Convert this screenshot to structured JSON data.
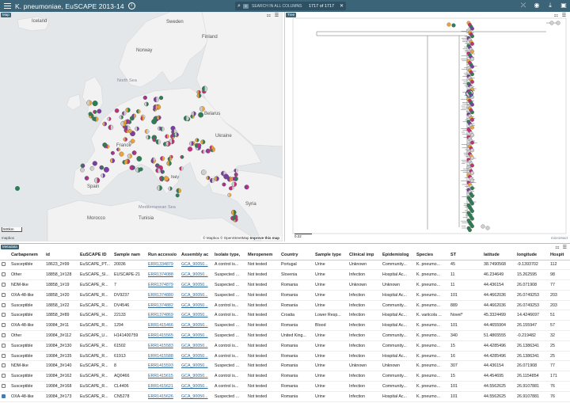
{
  "header": {
    "title": "K. pneumoniae, EuSCAPE 2013-14",
    "search_placeholder": "SEARCH IN ALL COLUMNS",
    "search_count_label": "1717 of 1717",
    "info_icon": "info-icon",
    "icons": [
      "menu-icon",
      "search-icon",
      "close-icon",
      "lasso-icon",
      "eye-icon",
      "download-icon",
      "save-icon"
    ]
  },
  "map": {
    "tag": "Map",
    "labels": {
      "iceland": "Iceland",
      "sweden": "Sweden",
      "finland": "Finland",
      "norway": "Norway",
      "north_sea": "North Sea",
      "belarus": "Belarus",
      "ukraine": "Ukraine",
      "france": "France",
      "spain": "Spain",
      "mediterranean": "Mediterranean Sea",
      "morocco": "Morocco",
      "tunisia": "Tunisia",
      "syria": "Syria",
      "italy": "Italy"
    },
    "scale_label": "500km",
    "attribution_mapbox": "© Mapbox",
    "attribution_osm": "© OpenStreetMap",
    "attribution_improve": "Improve this map",
    "mapbox_logo": "mapbox"
  },
  "tree": {
    "tag": "Tree",
    "scale_label": "0.22",
    "brand": "microreact"
  },
  "table": {
    "tag": "Metadata",
    "columns": [
      "",
      "Carbapenem",
      "id",
      "EuSCAPE ID",
      "Sample nam",
      "Run accessio",
      "Assembly ac",
      "Isolate type,",
      "Meropenem",
      "Country",
      "Sample type",
      "Clinical imp",
      "Epidemiolog",
      "Species",
      "ST",
      "latitude",
      "longitude",
      "Hospit"
    ],
    "rows": [
      {
        "checked": false,
        "cells": [
          "Susceptible",
          "18623_2#99",
          "EuSCAPE_PT...",
          "20036",
          "ERR1334879",
          "GCA_90050...",
          "A control is...",
          "Not tested",
          "Portugal",
          "Urine",
          "Unknown",
          "Community...",
          "K. pneumo...",
          "45",
          "38.7490568",
          "-9.1393702",
          "112"
        ]
      },
      {
        "checked": false,
        "cells": [
          "Other",
          "18858_1#128",
          "EuSCAPE_SI...",
          "EUSCAPE-21",
          "ERR1374088",
          "GCA_90050...",
          "Suspected ...",
          "Not tested",
          "Slovenia",
          "Urine",
          "Infection",
          "Hospital Ac...",
          "K. pneumo...",
          "11",
          "46.234649",
          "15.262595",
          "98"
        ]
      },
      {
        "checked": false,
        "cells": [
          "NDM-like",
          "18858_1#19",
          "EuSCAPE_R...",
          "7",
          "ERR1374879",
          "GCA_90050...",
          "Suspected ...",
          "Not tested",
          "Romania",
          "Urine",
          "Unknown",
          "Unknown",
          "K. pneumo...",
          "11",
          "44.436154",
          "26.071908",
          "77"
        ]
      },
      {
        "checked": false,
        "cells": [
          "OXA-48-like",
          "18858_1#20",
          "EuSCAPE_R...",
          "DV9237",
          "ERR1374880",
          "GCA_90050...",
          "Suspected ...",
          "Not tested",
          "Romania",
          "Urine",
          "Infection",
          "Hospital Ac...",
          "K. pneumo...",
          "101",
          "44.4662036",
          "26.0749253",
          "203"
        ]
      },
      {
        "checked": false,
        "cells": [
          "Susceptible",
          "18858_1#22",
          "EuSCAPE_R...",
          "DV4546",
          "ERR1374882",
          "GCA_90050...",
          "A control is...",
          "Not tested",
          "Romania",
          "Urine",
          "Infection",
          "Community...",
          "K. pneumo...",
          "889",
          "44.4662036",
          "26.0749253",
          "203"
        ]
      },
      {
        "checked": false,
        "cells": [
          "Susceptible",
          "18858_3#89",
          "EuSCAPE_H...",
          "22133",
          "ERR1374869",
          "GCA_90050...",
          "A control is...",
          "Not tested",
          "Croatia",
          "Lower Resp...",
          "Infection",
          "Hospital Ac...",
          "K. variicola ...",
          "Novel*",
          "45.3324499",
          "14.4246697",
          "51"
        ]
      },
      {
        "checked": false,
        "cells": [
          "OXA-48-like",
          "19084_3#11",
          "EuSCAPE_R...",
          "1294",
          "ERR1415466",
          "GCA_90050...",
          "Suspected ...",
          "Not tested",
          "Romania",
          "Blood",
          "Infection",
          "Hospital Ac...",
          "K. pneumo...",
          "101",
          "44.4655904",
          "26.155947",
          "57"
        ]
      },
      {
        "checked": false,
        "cells": [
          "Other",
          "19084_3#112",
          "EuSCAPE_U...",
          "H141400759",
          "ERR1415565",
          "GCA_90050...",
          "Suspected ...",
          "Not tested",
          "United King...",
          "Urine",
          "Infection",
          "Community...",
          "K. pneumo...",
          "340",
          "51.4865555",
          "-0.219482",
          "32"
        ]
      },
      {
        "checked": false,
        "cells": [
          "Susceptible",
          "19084_3#130",
          "EuSCAPE_R...",
          "61502",
          "ERR1415583",
          "GCA_90050...",
          "A control is...",
          "Not tested",
          "Romania",
          "Urine",
          "Infection",
          "Community...",
          "K. pneumo...",
          "15",
          "44.4285496",
          "26.1386341",
          "25"
        ]
      },
      {
        "checked": false,
        "cells": [
          "Susceptible",
          "19084_3#135",
          "EuSCAPE_R...",
          "61913",
          "ERR1415588",
          "GCA_90050...",
          "A control is...",
          "Not tested",
          "Romania",
          "Urine",
          "Infection",
          "Hospital Ac...",
          "K. pneumo...",
          "16",
          "44.4285496",
          "26.1386341",
          "25"
        ]
      },
      {
        "checked": false,
        "cells": [
          "NDM-like",
          "19084_3#140",
          "EuSCAPE_R...",
          "8",
          "ERR1415593",
          "GCA_90050...",
          "Suspected ...",
          "Not tested",
          "Romania",
          "Urine",
          "Unknown",
          "Unknown",
          "K. pneumo...",
          "307",
          "44.436154",
          "26.071908",
          "77"
        ]
      },
      {
        "checked": false,
        "cells": [
          "Susceptible",
          "19084_3#162",
          "EuSCAPE_R...",
          "AQ0466",
          "ERR1415615",
          "GCA_90050...",
          "A control is...",
          "Not tested",
          "Romania",
          "Urine",
          "Infection",
          "Community...",
          "K. pneumo...",
          "15",
          "44.454695",
          "26.1154854",
          "171"
        ]
      },
      {
        "checked": false,
        "cells": [
          "Susceptible",
          "19084_3#168",
          "EuSCAPE_R...",
          "CL4406",
          "ERR1415621",
          "GCA_90050...",
          "A control is...",
          "Not tested",
          "Romania",
          "Urine",
          "Infection",
          "Community...",
          "K. pneumo...",
          "101",
          "44.5562625",
          "26.9107881",
          "76"
        ]
      },
      {
        "checked": true,
        "cells": [
          "OXA-48-like",
          "19084_3#173",
          "EuSCAPE_R...",
          "CN5278",
          "ERR1415626",
          "GCA_90050...",
          "Suspected ...",
          "Not tested",
          "Romania",
          "Urine",
          "Infection",
          "Hospital Ac...",
          "K. pneumo...",
          "101",
          "44.5562625",
          "26.9107881",
          "76"
        ]
      }
    ]
  },
  "colors": {
    "header_bg": "#3b6478",
    "susceptible": "#e9a33a",
    "oxa48": "#c0317a",
    "ndm": "#2e7d55",
    "kpc": "#7b3fa0",
    "other": "#cfcfcf"
  }
}
